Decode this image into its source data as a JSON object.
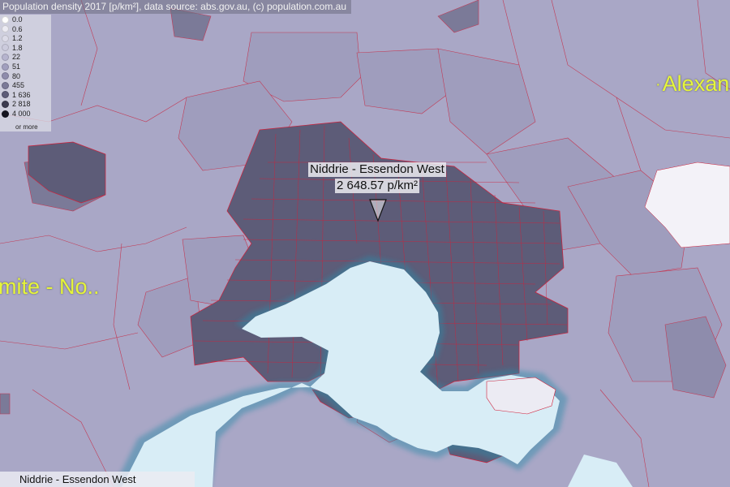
{
  "header": {
    "title": "Population density 2017 [p/km²], data source: abs.gov.au, (c) population.com.au"
  },
  "legend": {
    "items": [
      {
        "label": "0.0",
        "color": "#ffffff"
      },
      {
        "label": "0.6",
        "color": "#ecebf3"
      },
      {
        "label": "1.2",
        "color": "#dcdbe8"
      },
      {
        "label": "1.8",
        "color": "#cccbdd"
      },
      {
        "label": "22",
        "color": "#b6b4ce"
      },
      {
        "label": "51",
        "color": "#a19fbe"
      },
      {
        "label": "80",
        "color": "#8e8cac"
      },
      {
        "label": "455",
        "color": "#7b7a98"
      },
      {
        "label": "1 636",
        "color": "#5d5c78"
      },
      {
        "label": "2 818",
        "color": "#3c3b50"
      },
      {
        "label": "4 000",
        "color": "#151520"
      }
    ],
    "note": "or more"
  },
  "map": {
    "labels": {
      "right": "Alexan",
      "left": "mite - No.."
    },
    "callout": {
      "name": "Niddrie - Essendon West",
      "value": "2 648.57 p/km²"
    },
    "colors": {
      "base": "#a9a7c6",
      "dense": "#5d5c78",
      "boundary": "#d0203a",
      "water": "#d8edf6",
      "label": "#e6f53a"
    }
  },
  "status": {
    "selected": "Niddrie - Essendon West"
  }
}
